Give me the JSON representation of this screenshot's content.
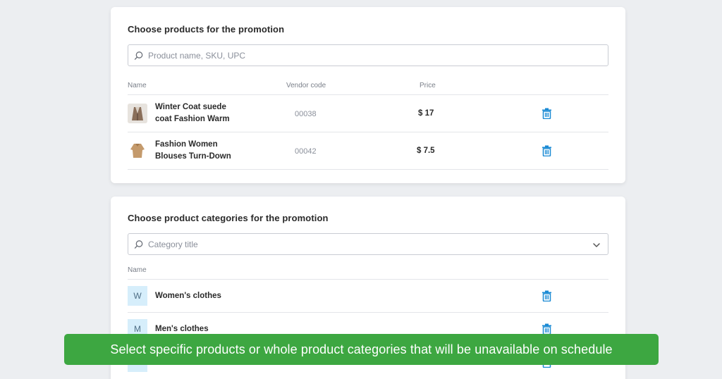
{
  "products_card": {
    "title": "Choose products for the promotion",
    "search_placeholder": "Product name, SKU, UPC",
    "columns": {
      "name": "Name",
      "vendor_code": "Vendor code",
      "price": "Price"
    },
    "rows": [
      {
        "name_line1": "Winter Coat suede",
        "name_line2": "coat Fashion Warm",
        "vendor_code": "00038",
        "price": "$ 17",
        "thumb_icon": "coat-thumbnail"
      },
      {
        "name_line1": "Fashion Women",
        "name_line2": "Blouses Turn-Down",
        "vendor_code": "00042",
        "price": "$ 7.5",
        "thumb_icon": "blouse-thumbnail"
      }
    ]
  },
  "categories_card": {
    "title": "Choose product categories for the promotion",
    "search_placeholder": "Category title",
    "columns": {
      "name": "Name"
    },
    "rows": [
      {
        "letter": "W",
        "name": "Women's clothes"
      },
      {
        "letter": "M",
        "name": "Men's clothes"
      }
    ]
  },
  "banner": {
    "text": "Select specific products or whole product categories that will be unavailable on schedule"
  },
  "colors": {
    "accent": "#1a8ad4",
    "banner_bg": "#3da741",
    "letter_bg": "#d6eefb"
  }
}
